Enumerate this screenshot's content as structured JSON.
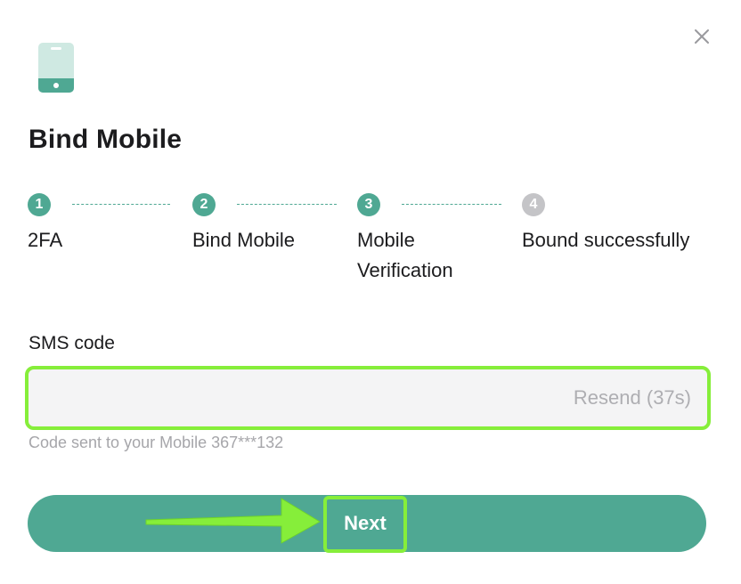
{
  "dialog": {
    "title": "Bind Mobile",
    "close_icon": "close-icon",
    "header_icon": "mobile-phone-icon"
  },
  "steps": [
    {
      "number": "1",
      "label": "2FA",
      "state": "complete"
    },
    {
      "number": "2",
      "label": "Bind Mobile",
      "state": "complete"
    },
    {
      "number": "3",
      "label": "Mobile Verification",
      "state": "current"
    },
    {
      "number": "4",
      "label": "Bound successfully",
      "state": "pending"
    }
  ],
  "sms": {
    "label": "SMS code",
    "value": "",
    "resend_label": "Resend (37s)",
    "hint": "Code sent to your Mobile 367***132"
  },
  "actions": {
    "next_label": "Next"
  },
  "colors": {
    "accent": "#4fa893",
    "inactive": "#c4c4c7",
    "highlight": "#86ee3a"
  }
}
